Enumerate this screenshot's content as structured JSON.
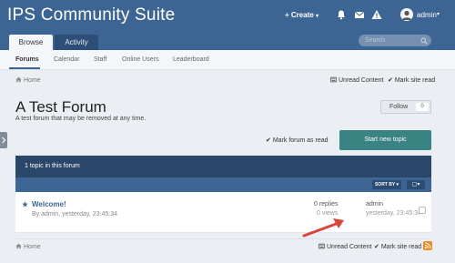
{
  "header": {
    "logo": "IPS Community Suite",
    "create_label": "Create",
    "user_name": "admin"
  },
  "nav": {
    "tabs": [
      {
        "label": "Browse"
      },
      {
        "label": "Activity"
      }
    ],
    "search_placeholder": "Search"
  },
  "subnav": {
    "items": [
      {
        "label": "Forums"
      },
      {
        "label": "Calendar"
      },
      {
        "label": "Staff"
      },
      {
        "label": "Online Users"
      },
      {
        "label": "Leaderboard"
      }
    ]
  },
  "breadcrumb": {
    "home": "Home",
    "unread": "Unread Content",
    "mark_site": "Mark site read"
  },
  "forum": {
    "title": "A Test Forum",
    "description": "A test forum that may be removed at any time.",
    "follow_label": "Follow",
    "follow_count": "0",
    "mark_forum_read": "Mark forum as read",
    "start_topic": "Start new topic",
    "topic_count": "1 topic in this forum",
    "sort_label": "SORT BY",
    "topics": [
      {
        "title": "Welcome!",
        "meta": "By admin, yesterday, 23:45:34",
        "replies": "0 replies",
        "views": "0 views",
        "last_user": "admin",
        "last_time": "yesterday, 23:45:34"
      }
    ]
  },
  "footer": {
    "home": "Home",
    "unread": "Unread Content",
    "mark_site": "Mark site read"
  },
  "colors": {
    "header_bg": "#3d6594",
    "start_topic_bg": "#3a8383",
    "rss": "#f08a24",
    "arrow": "#d9453c"
  }
}
